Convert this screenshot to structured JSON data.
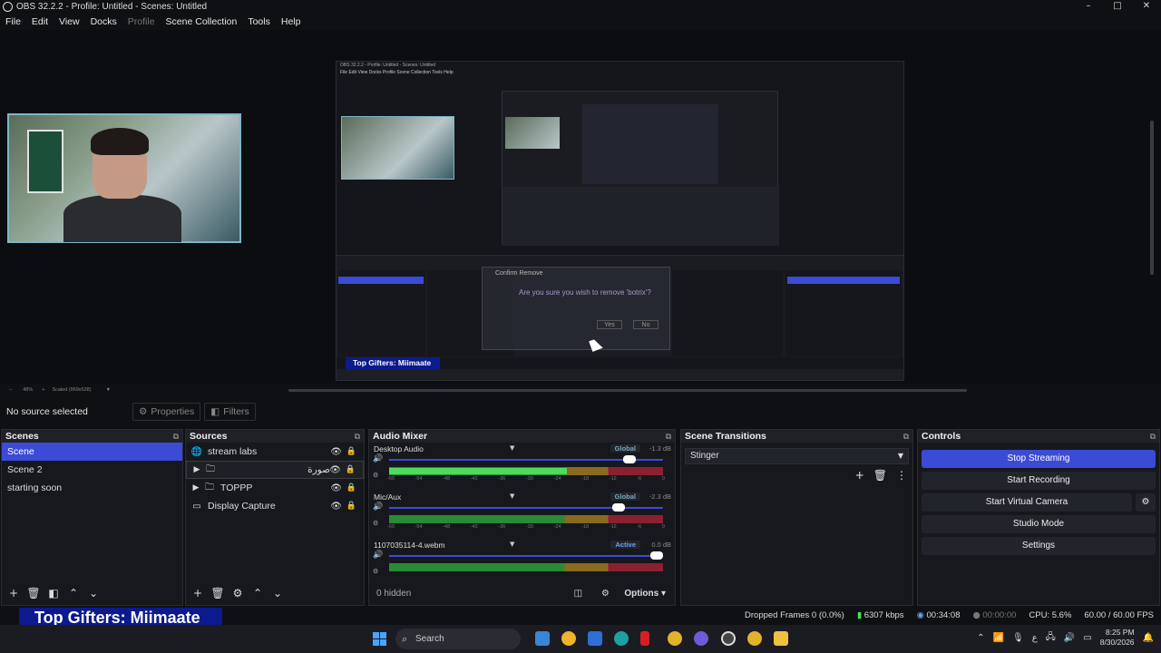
{
  "window": {
    "title": "OBS 32.2.2 - Profile: Untitled - Scenes: Untitled",
    "controls": [
      "–",
      "□",
      "✕"
    ]
  },
  "menu": [
    "File",
    "Edit",
    "View",
    "Docks",
    "Profile",
    "Scene Collection",
    "Tools",
    "Help"
  ],
  "preview": {
    "nested_title": "OBS 32.2.2 - Profile: Untitled - Scenes: Untitled",
    "nested_menu": "File  Edit  View  Docks  Profile  Scene Collection  Tools  Help",
    "dialog_title": "Confirm Remove",
    "dialog_text": "Are you sure you wish to remove 'botrix'?",
    "dialog_yes": "Yes",
    "dialog_no": "No",
    "nested_gifters": "Top Gifters: Miimaate",
    "zoom": "48%",
    "scaled": "Scaled (969x528)"
  },
  "source_toolbar": {
    "no_source": "No source selected",
    "properties": "Properties",
    "filters": "Filters"
  },
  "scenes": {
    "title": "Scenes",
    "items": [
      "Scene",
      "Scene 2",
      "starting soon"
    ],
    "selected": "Scene"
  },
  "sources": {
    "title": "Sources",
    "items": [
      {
        "name": "stream labs",
        "icon": "globe-icon"
      },
      {
        "name": "صورة",
        "icon": "folder-icon"
      },
      {
        "name": "TOPPP",
        "icon": "folder-icon"
      },
      {
        "name": "Display Capture",
        "icon": "monitor-icon"
      }
    ]
  },
  "mixer": {
    "title": "Audio Mixer",
    "channels": [
      {
        "name": "Desktop Audio",
        "badge": "Global",
        "db": "-1.3 dB",
        "volume": 0.9,
        "level": 0.65
      },
      {
        "name": "Mic/Aux",
        "badge": "Global",
        "db": "-2.3 dB",
        "volume": 0.86,
        "level": 0.0
      },
      {
        "name": "1107035114-4.webm",
        "badge": "Active",
        "db": "0.0 dB",
        "volume": 1.0,
        "level": 0.0
      }
    ],
    "ticks": [
      "-60",
      "-54",
      "-48",
      "-42",
      "-36",
      "-30",
      "-24",
      "-18",
      "-12",
      "-6",
      "0"
    ],
    "hidden": "0 hidden",
    "options": "Options"
  },
  "transitions": {
    "title": "Scene Transitions",
    "selected": "Stinger"
  },
  "controls": {
    "title": "Controls",
    "buttons": [
      "Stop Streaming",
      "Start Recording",
      "Start Virtual Camera",
      "Studio Mode",
      "Settings"
    ]
  },
  "status": {
    "dropped": "Dropped Frames 0 (0.0%)",
    "bitrate": "6307 kbps",
    "stream_time": "00:34:08",
    "rec_time": "00:00:00",
    "cpu": "CPU: 5.6%",
    "fps": "60.00 / 60.00 FPS"
  },
  "overlay": {
    "gifters": "Top Gifters: Miimaate"
  },
  "taskbar": {
    "search": "Search",
    "time": "8:25 PM",
    "date": "8/30/2026",
    "lang": "ع"
  },
  "colors": {
    "accent": "#3b4bd6",
    "gifters_bg": "#0b1a8c"
  }
}
